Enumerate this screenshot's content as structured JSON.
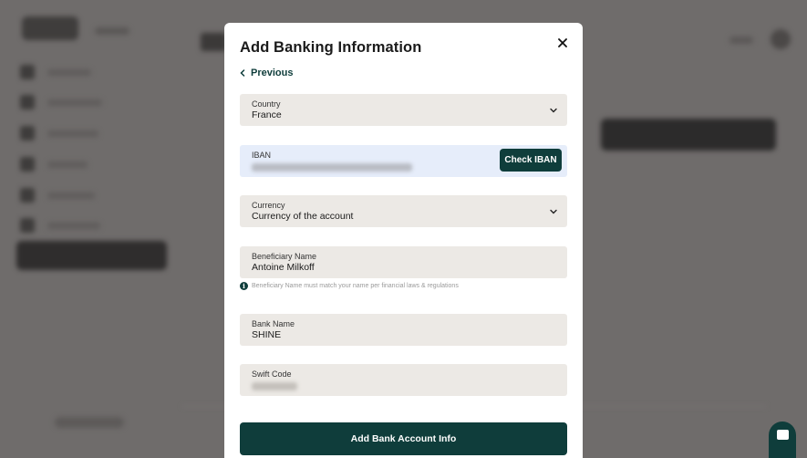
{
  "modal": {
    "title": "Add Banking Information",
    "close_icon": "close-icon",
    "previous_label": "Previous",
    "previous_icon": "chevron-left-icon",
    "fields": {
      "country": {
        "label": "Country",
        "value": "France",
        "icon": "chevron-down-icon"
      },
      "iban": {
        "label": "IBAN",
        "check_button": "Check IBAN"
      },
      "currency": {
        "label": "Currency",
        "value": "Currency of the account",
        "icon": "chevron-down-icon"
      },
      "beneficiary": {
        "label": "Beneficiary Name",
        "value": "Antoine Milkoff"
      },
      "beneficiary_hint": "Beneficiary Name must match your name per financial laws & regulations",
      "bank_name": {
        "label": "Bank Name",
        "value": "SHINE"
      },
      "swift": {
        "label": "Swift Code"
      }
    },
    "submit_label": "Add Bank Account Info"
  },
  "chat_launcher_icon": "chat-icon",
  "colors": {
    "accent": "#0f3d3b",
    "field_bg": "#ece9e5",
    "iban_bg": "#e6edfa",
    "overlay": "#6f6c6b"
  }
}
